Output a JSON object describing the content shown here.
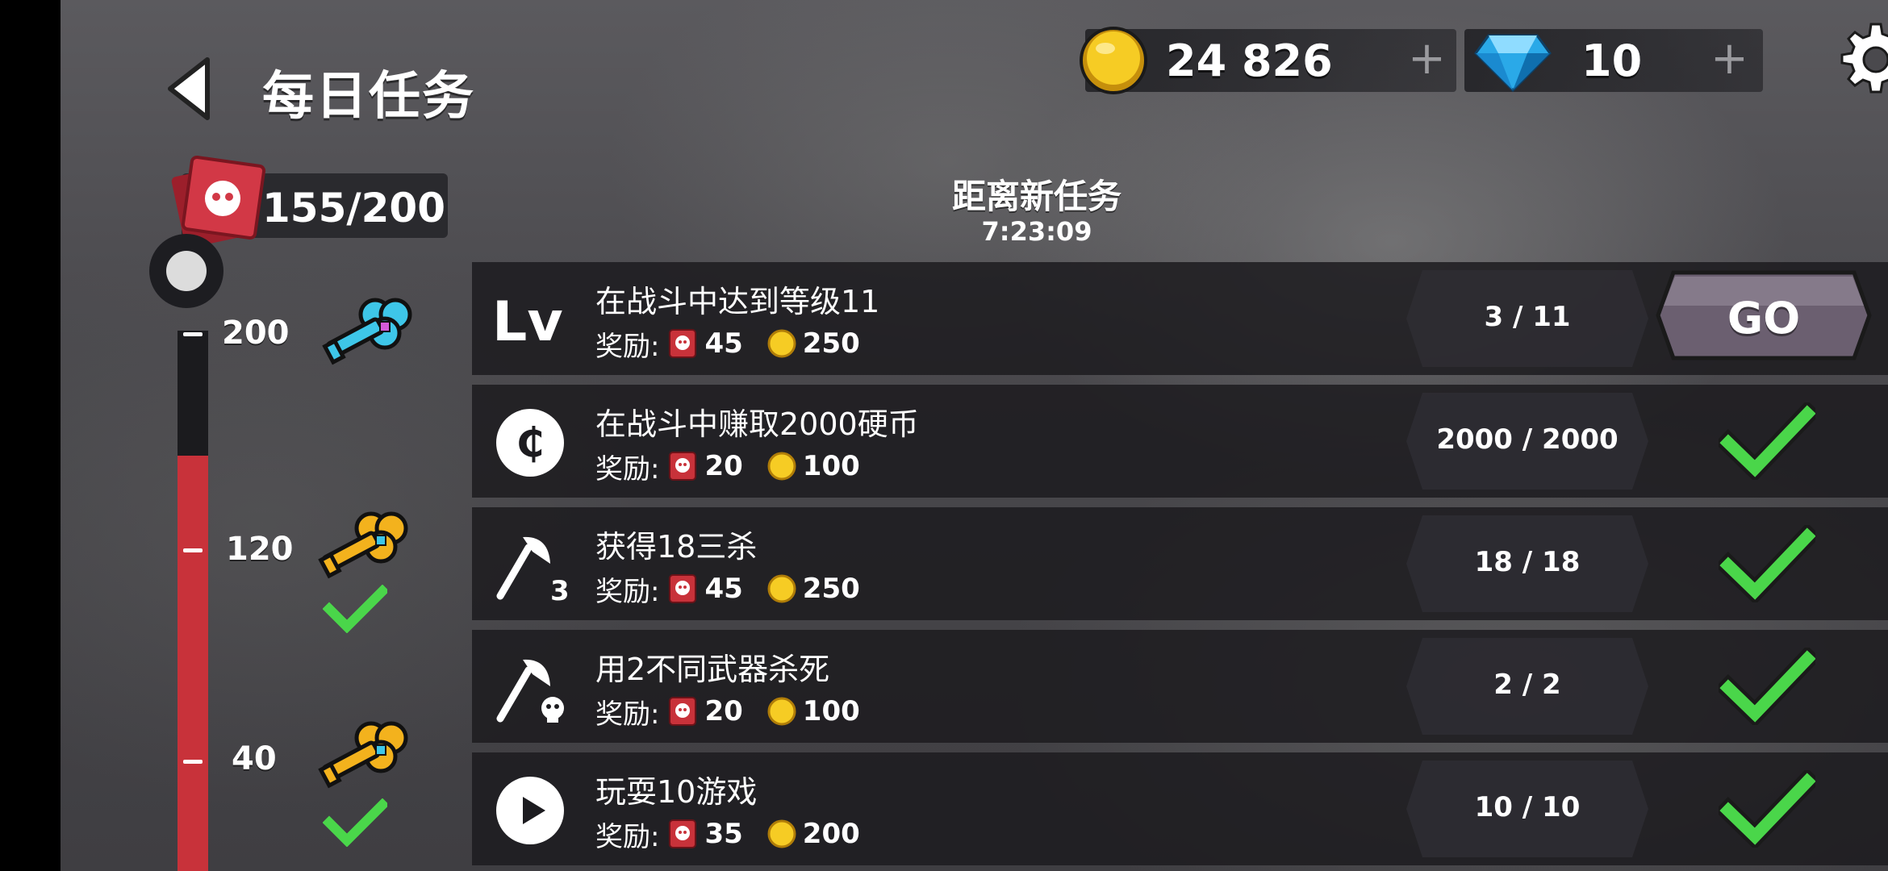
{
  "header": {
    "title": "每日任务"
  },
  "currency": {
    "coins": "24 826",
    "gems": "10",
    "plus": "+"
  },
  "tokens": {
    "value": "155/200"
  },
  "milestones": [
    {
      "value": "200",
      "key_color": "cyan",
      "claimed": false
    },
    {
      "value": "120",
      "key_color": "gold",
      "claimed": true
    },
    {
      "value": "40",
      "key_color": "gold",
      "claimed": true
    }
  ],
  "progress_fraction": 0.775,
  "timer": {
    "label": "距离新任务",
    "value": "7:23:09"
  },
  "reward_label": "奖励:",
  "tasks": [
    {
      "icon": "level-icon",
      "icon_text": "Lv",
      "title": "在战斗中达到等级11",
      "tickets": "45",
      "coins": "250",
      "progress": "3 / 11",
      "status": "go",
      "button": "GO"
    },
    {
      "icon": "coin-circle-icon",
      "icon_text": "₵",
      "title": "在战斗中赚取2000硬币",
      "tickets": "20",
      "coins": "100",
      "progress": "2000 / 2000",
      "status": "done"
    },
    {
      "icon": "triple-kill-icon",
      "icon_text": "3",
      "title": "获得18三杀",
      "tickets": "45",
      "coins": "250",
      "progress": "18 / 18",
      "status": "done"
    },
    {
      "icon": "weapon-kill-icon",
      "title": "用2不同武器杀死",
      "tickets": "20",
      "coins": "100",
      "progress": "2 / 2",
      "status": "done"
    },
    {
      "icon": "play-icon",
      "title": "玩耍10游戏",
      "tickets": "35",
      "coins": "200",
      "progress": "10 / 10",
      "status": "done"
    }
  ],
  "colors": {
    "accent_red": "#c8323a",
    "check_green": "#4ad64a",
    "go_button": "#6b5f70"
  }
}
